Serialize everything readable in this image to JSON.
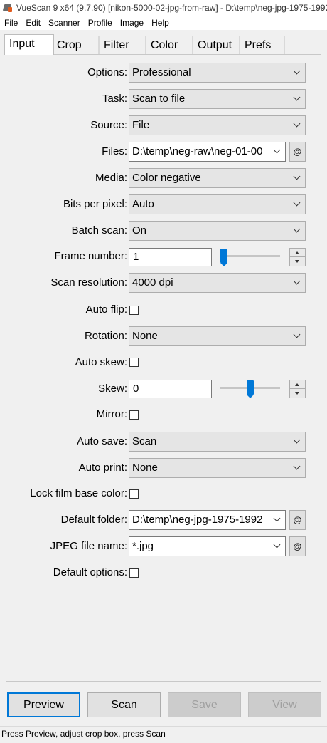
{
  "window": {
    "title": "VueScan 9 x64 (9.7.90) [nikon-5000-02-jpg-from-raw] - D:\\temp\\neg-jpg-1975-1992"
  },
  "menu": [
    "File",
    "Edit",
    "Scanner",
    "Profile",
    "Image",
    "Help"
  ],
  "tabs": [
    "Input",
    "Crop",
    "Filter",
    "Color",
    "Output",
    "Prefs"
  ],
  "active_tab": "Input",
  "fields": {
    "options": {
      "label": "Options:",
      "value": "Professional"
    },
    "task": {
      "label": "Task:",
      "value": "Scan to file"
    },
    "source": {
      "label": "Source:",
      "value": "File"
    },
    "files": {
      "label": "Files:",
      "value": "D:\\temp\\neg-raw\\neg-01-00",
      "browse": "@"
    },
    "media": {
      "label": "Media:",
      "value": "Color negative"
    },
    "bits_per_pixel": {
      "label": "Bits per pixel:",
      "value": "Auto"
    },
    "batch_scan": {
      "label": "Batch scan:",
      "value": "On"
    },
    "frame_number": {
      "label": "Frame number:",
      "value": "1",
      "slider_position": 0.0
    },
    "scan_resolution": {
      "label": "Scan resolution:",
      "value": "4000 dpi"
    },
    "auto_flip": {
      "label": "Auto flip:",
      "checked": false
    },
    "rotation": {
      "label": "Rotation:",
      "value": "None"
    },
    "auto_skew": {
      "label": "Auto skew:",
      "checked": false
    },
    "skew": {
      "label": "Skew:",
      "value": "0",
      "slider_position": 0.5
    },
    "mirror": {
      "label": "Mirror:",
      "checked": false
    },
    "auto_save": {
      "label": "Auto save:",
      "value": "Scan"
    },
    "auto_print": {
      "label": "Auto print:",
      "value": "None"
    },
    "lock_film_base_color": {
      "label": "Lock film base color:",
      "checked": false
    },
    "default_folder": {
      "label": "Default folder:",
      "value": "D:\\temp\\neg-jpg-1975-1992",
      "browse": "@"
    },
    "jpeg_file_name": {
      "label": "JPEG file name:",
      "value": "*.jpg",
      "browse": "@"
    },
    "default_options": {
      "label": "Default options:",
      "checked": false
    }
  },
  "buttons": {
    "preview": "Preview",
    "scan": "Scan",
    "save": "Save",
    "view": "View"
  },
  "status": "Press Preview, adjust crop box, press Scan",
  "colors": {
    "accent": "#0078d7",
    "panel_bg": "#f0f0f0",
    "combo_bg": "#e5e5e5",
    "disabled_text": "#a0a0a0"
  }
}
